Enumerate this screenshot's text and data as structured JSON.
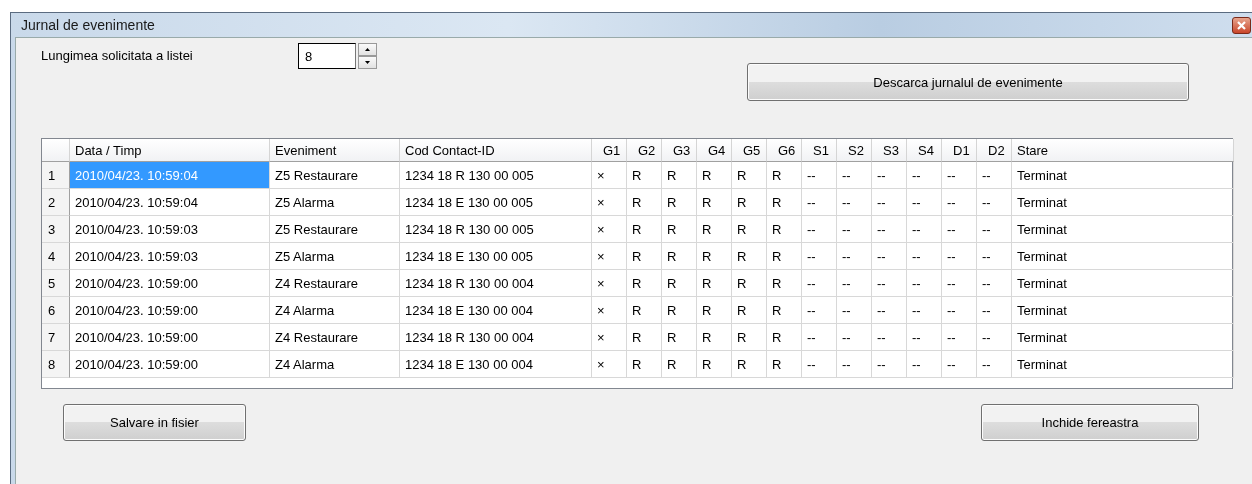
{
  "window": {
    "title": "Jurnal de evenimente"
  },
  "list_length": {
    "label": "Lungimea solicitata a listei",
    "value": "8"
  },
  "download_button": "Descarca jurnalul de evenimente",
  "table": {
    "columns": [
      "Data / Timp",
      "Eveniment",
      "Cod Contact-ID",
      "G1",
      "G2",
      "G3",
      "G4",
      "G5",
      "G6",
      "S1",
      "S2",
      "S3",
      "S4",
      "D1",
      "D2",
      "Stare"
    ],
    "rows": [
      {
        "index": "1",
        "selected": true,
        "cells": [
          "2010/04/23. 10:59:04",
          "Z5 Restaurare",
          "1234 18 R 130 00 005",
          "×",
          "R",
          "R",
          "R",
          "R",
          "R",
          "--",
          "--",
          "--",
          "--",
          "--",
          "--",
          "Terminat"
        ]
      },
      {
        "index": "2",
        "selected": false,
        "cells": [
          "2010/04/23. 10:59:04",
          "Z5 Alarma",
          "1234 18 E 130 00 005",
          "×",
          "R",
          "R",
          "R",
          "R",
          "R",
          "--",
          "--",
          "--",
          "--",
          "--",
          "--",
          "Terminat"
        ]
      },
      {
        "index": "3",
        "selected": false,
        "cells": [
          "2010/04/23. 10:59:03",
          "Z5 Restaurare",
          "1234 18 R 130 00 005",
          "×",
          "R",
          "R",
          "R",
          "R",
          "R",
          "--",
          "--",
          "--",
          "--",
          "--",
          "--",
          "Terminat"
        ]
      },
      {
        "index": "4",
        "selected": false,
        "cells": [
          "2010/04/23. 10:59:03",
          "Z5 Alarma",
          "1234 18 E 130 00 005",
          "×",
          "R",
          "R",
          "R",
          "R",
          "R",
          "--",
          "--",
          "--",
          "--",
          "--",
          "--",
          "Terminat"
        ]
      },
      {
        "index": "5",
        "selected": false,
        "cells": [
          "2010/04/23. 10:59:00",
          "Z4 Restaurare",
          "1234 18 R 130 00 004",
          "×",
          "R",
          "R",
          "R",
          "R",
          "R",
          "--",
          "--",
          "--",
          "--",
          "--",
          "--",
          "Terminat"
        ]
      },
      {
        "index": "6",
        "selected": false,
        "cells": [
          "2010/04/23. 10:59:00",
          "Z4 Alarma",
          "1234 18 E 130 00 004",
          "×",
          "R",
          "R",
          "R",
          "R",
          "R",
          "--",
          "--",
          "--",
          "--",
          "--",
          "--",
          "Terminat"
        ]
      },
      {
        "index": "7",
        "selected": false,
        "cells": [
          "2010/04/23. 10:59:00",
          "Z4 Restaurare",
          "1234 18 R 130 00 004",
          "×",
          "R",
          "R",
          "R",
          "R",
          "R",
          "--",
          "--",
          "--",
          "--",
          "--",
          "--",
          "Terminat"
        ]
      },
      {
        "index": "8",
        "selected": false,
        "cells": [
          "2010/04/23. 10:59:00",
          "Z4 Alarma",
          "1234 18 E 130 00 004",
          "×",
          "R",
          "R",
          "R",
          "R",
          "R",
          "--",
          "--",
          "--",
          "--",
          "--",
          "--",
          "Terminat"
        ]
      }
    ]
  },
  "buttons": [
    "Salvare in fisier",
    "Inchide fereastra"
  ]
}
